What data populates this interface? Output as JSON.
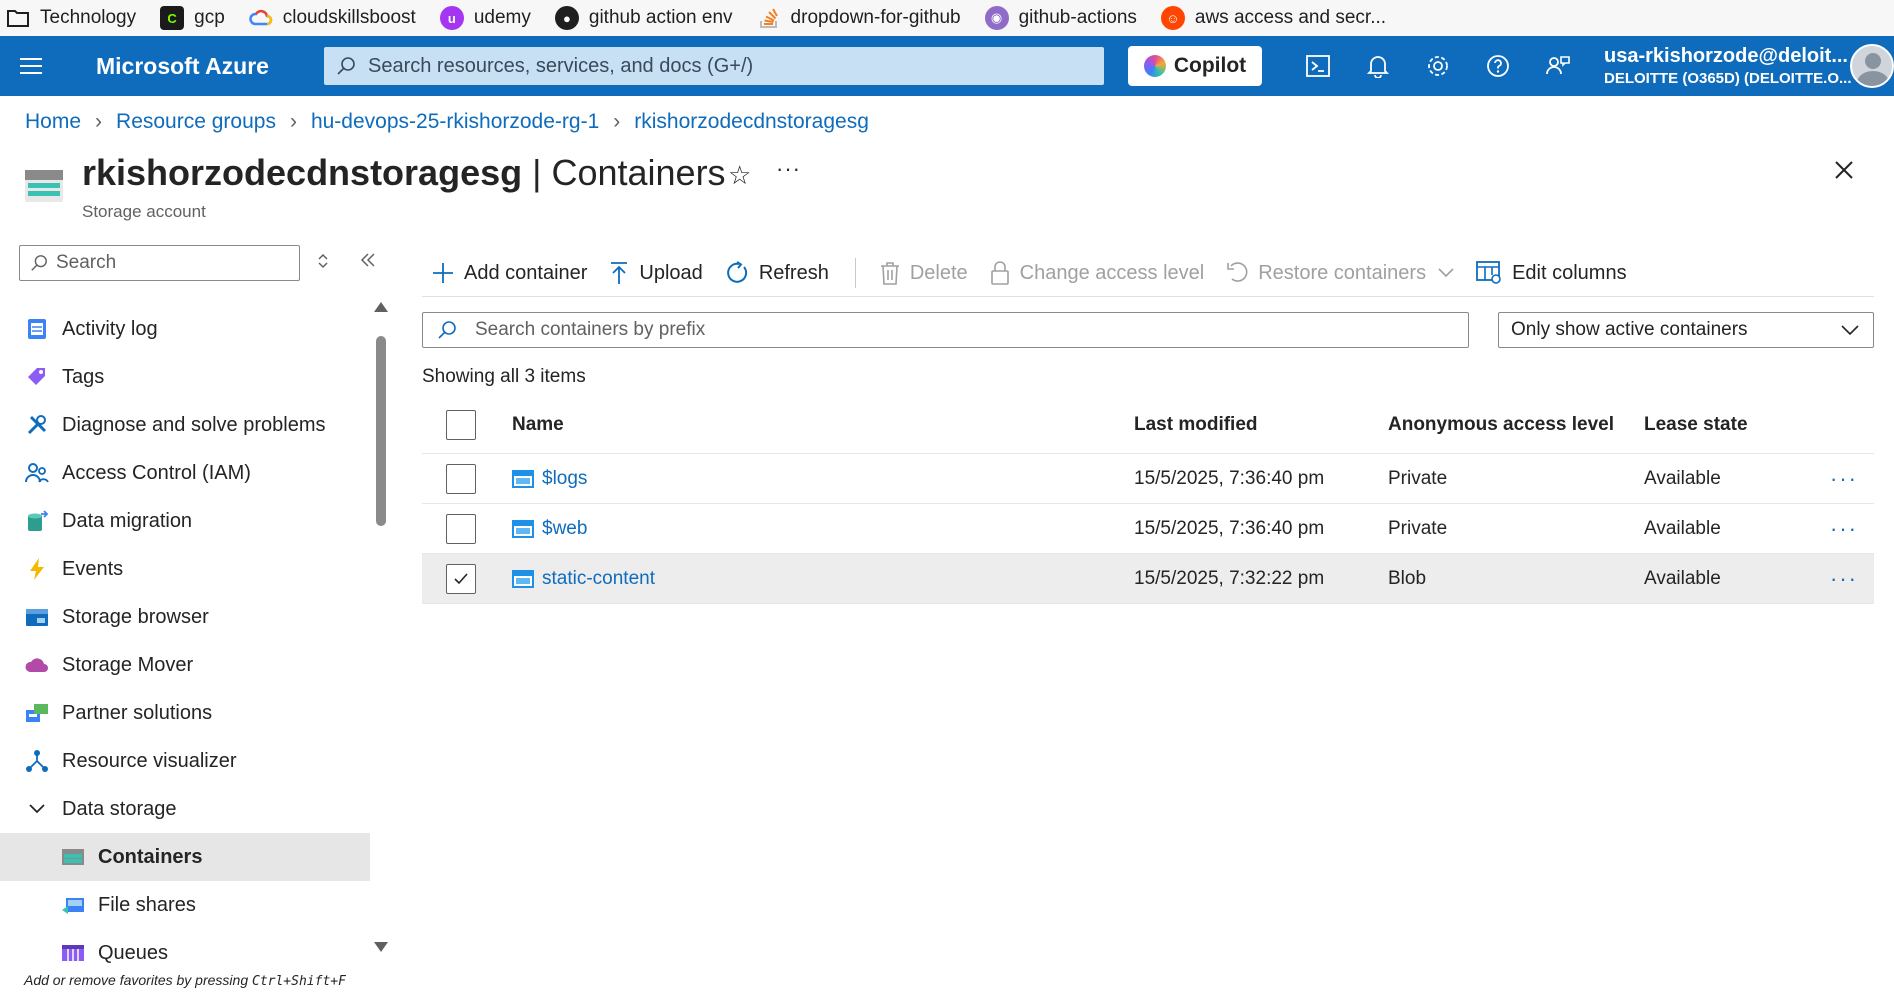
{
  "bookmarks": [
    {
      "label": "Technology",
      "icon": "folder-icon",
      "color": "#1f1f1f"
    },
    {
      "label": "gcp",
      "icon": "gcp-icon",
      "color": "#1a1a1a"
    },
    {
      "label": "cloudskillsboost",
      "icon": "google-cloud-icon",
      "color": "#4285f4"
    },
    {
      "label": "udemy",
      "icon": "udemy-icon",
      "color": "#a435f0"
    },
    {
      "label": "github action env",
      "icon": "github-icon",
      "color": "#1f1f1f"
    },
    {
      "label": "dropdown-for-github",
      "icon": "stackoverflow-icon",
      "color": "#f48024"
    },
    {
      "label": "github-actions",
      "icon": "github-octocat-icon",
      "color": "#8e6cc7"
    },
    {
      "label": "aws access and secr...",
      "icon": "reddit-icon",
      "color": "#ff4500"
    }
  ],
  "topbar": {
    "brand": "Microsoft Azure",
    "search_placeholder": "Search resources, services, and docs (G+/)",
    "copilot_label": "Copilot",
    "account_name": "usa-rkishorzode@deloit...",
    "account_tenant": "DELOITTE (O365D) (DELOITTE.O...",
    "bg_color": "#0f6cbd"
  },
  "breadcrumb": [
    {
      "label": "Home"
    },
    {
      "label": "Resource groups"
    },
    {
      "label": "hu-devops-25-rkishorzode-rg-1"
    },
    {
      "label": "rkishorzodecdnstoragesg"
    }
  ],
  "header": {
    "resource_name": "rkishorzodecdnstoragesg",
    "title_suffix": " | Containers",
    "subtitle": "Storage account",
    "star": "☆",
    "more": "···"
  },
  "sidebar": {
    "search_placeholder": "Search",
    "items": [
      {
        "label": "Activity log",
        "icon": "activity-log-icon"
      },
      {
        "label": "Tags",
        "icon": "tag-icon"
      },
      {
        "label": "Diagnose and solve problems",
        "icon": "wrench-icon"
      },
      {
        "label": "Access Control (IAM)",
        "icon": "people-icon"
      },
      {
        "label": "Data migration",
        "icon": "data-migration-icon"
      },
      {
        "label": "Events",
        "icon": "lightning-icon"
      },
      {
        "label": "Storage browser",
        "icon": "storage-browser-icon"
      },
      {
        "label": "Storage Mover",
        "icon": "cloud-icon"
      },
      {
        "label": "Partner solutions",
        "icon": "partner-icon"
      },
      {
        "label": "Resource visualizer",
        "icon": "visualizer-icon"
      },
      {
        "label": "Data storage",
        "icon": "chevron-down-icon"
      },
      {
        "label": "Containers",
        "icon": "containers-icon"
      },
      {
        "label": "File shares",
        "icon": "file-shares-icon"
      },
      {
        "label": "Queues",
        "icon": "queues-icon"
      }
    ],
    "fav_hint_prefix": "Add or remove favorites by pressing ",
    "fav_hint_keys": "Ctrl+Shift+F"
  },
  "toolbar": {
    "add_container": "Add container",
    "upload": "Upload",
    "refresh": "Refresh",
    "delete": "Delete",
    "change_access": "Change access level",
    "restore": "Restore containers",
    "edit_columns": "Edit columns"
  },
  "filter": {
    "search_placeholder": "Search containers by prefix",
    "select_value": "Only show active containers"
  },
  "showing_text": "Showing all 3 items",
  "table": {
    "columns": [
      "Name",
      "Last modified",
      "Anonymous access level",
      "Lease state"
    ],
    "rows": [
      {
        "name": "$logs",
        "modified": "15/5/2025, 7:36:40 pm",
        "access": "Private",
        "lease": "Available",
        "checked": false
      },
      {
        "name": "$web",
        "modified": "15/5/2025, 7:36:40 pm",
        "access": "Private",
        "lease": "Available",
        "checked": false
      },
      {
        "name": "static-content",
        "modified": "15/5/2025, 7:32:22 pm",
        "access": "Blob",
        "lease": "Available",
        "checked": true
      }
    ],
    "more": "···"
  }
}
